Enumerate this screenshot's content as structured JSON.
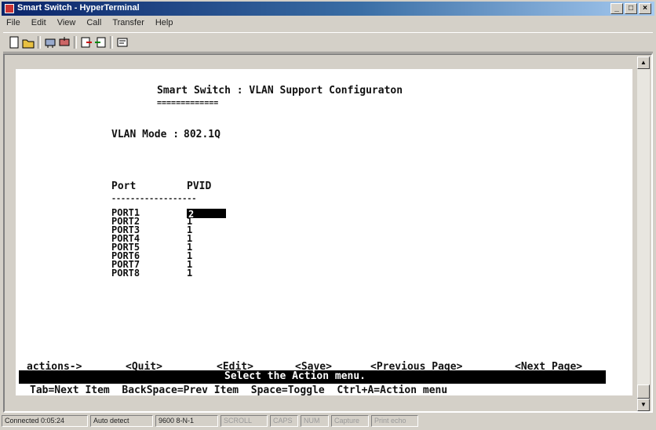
{
  "window": {
    "title": "Smart Switch - HyperTerminal"
  },
  "menu": [
    "File",
    "Edit",
    "View",
    "Call",
    "Transfer",
    "Help"
  ],
  "toolbar": [
    "new-icon",
    "open-icon",
    "connect-icon",
    "disconnect-icon",
    "send-icon",
    "receive-icon",
    "properties-icon"
  ],
  "screen": {
    "title": "Smart Switch : VLAN Support Configuraton",
    "title_underline": "=============",
    "vlan_mode_label": "VLAN Mode :",
    "vlan_mode_value": "802.1Q",
    "port_header": "Port",
    "pvid_header": "PVID",
    "header_underline": "------------------",
    "ports": [
      {
        "port": "PORT1",
        "pvid": "2"
      },
      {
        "port": "PORT2",
        "pvid": "1"
      },
      {
        "port": "PORT3",
        "pvid": "1"
      },
      {
        "port": "PORT4",
        "pvid": "1"
      },
      {
        "port": "PORT5",
        "pvid": "1"
      },
      {
        "port": "PORT6",
        "pvid": "1"
      },
      {
        "port": "PORT7",
        "pvid": "1"
      },
      {
        "port": "PORT8",
        "pvid": "1"
      }
    ],
    "actions_label": "actions->",
    "actions": [
      "<Quit>",
      "<Edit>",
      "<Save>",
      "<Previous Page>",
      "<Next Page>"
    ],
    "message": "Select the Action menu.",
    "help": "Tab=Next Item  BackSpace=Prev Item  Space=Toggle  Ctrl+A=Action menu"
  },
  "status": {
    "connected": "Connected 0:05:24",
    "detect": "Auto detect",
    "settings": "9600 8-N-1",
    "scroll": "SCROLL",
    "caps": "CAPS",
    "num": "NUM",
    "capture": "Capture",
    "print": "Print echo"
  }
}
